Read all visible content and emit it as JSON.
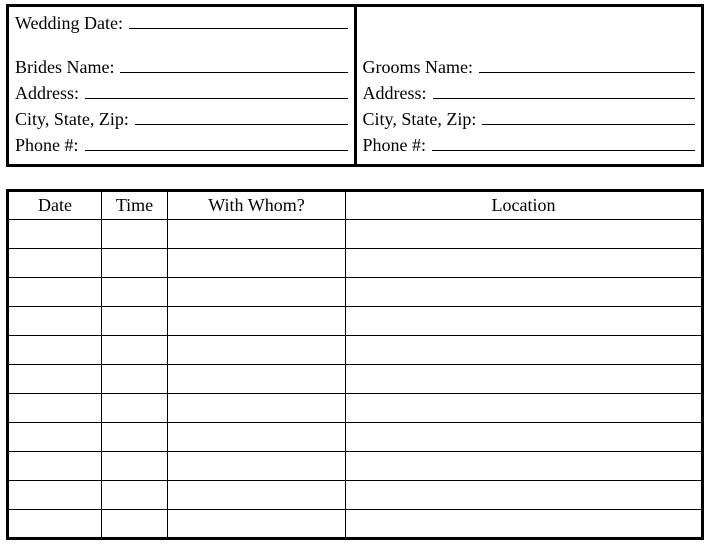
{
  "top": {
    "left": {
      "wedding_date": "Wedding Date:",
      "brides_name": "Brides Name:",
      "address": "Address:",
      "city_state_zip": "City, State, Zip:",
      "phone": "Phone #:"
    },
    "right": {
      "grooms_name": "Grooms Name:",
      "address": "Address:",
      "city_state_zip": "City, State, Zip:",
      "phone": "Phone #:"
    }
  },
  "table": {
    "headers": {
      "date": "Date",
      "time": "Time",
      "whom": "With Whom?",
      "location": "Location"
    },
    "rows": [
      {
        "date": "",
        "time": "",
        "whom": "",
        "location": ""
      },
      {
        "date": "",
        "time": "",
        "whom": "",
        "location": ""
      },
      {
        "date": "",
        "time": "",
        "whom": "",
        "location": ""
      },
      {
        "date": "",
        "time": "",
        "whom": "",
        "location": ""
      },
      {
        "date": "",
        "time": "",
        "whom": "",
        "location": ""
      },
      {
        "date": "",
        "time": "",
        "whom": "",
        "location": ""
      },
      {
        "date": "",
        "time": "",
        "whom": "",
        "location": ""
      },
      {
        "date": "",
        "time": "",
        "whom": "",
        "location": ""
      },
      {
        "date": "",
        "time": "",
        "whom": "",
        "location": ""
      },
      {
        "date": "",
        "time": "",
        "whom": "",
        "location": ""
      },
      {
        "date": "",
        "time": "",
        "whom": "",
        "location": ""
      }
    ]
  }
}
